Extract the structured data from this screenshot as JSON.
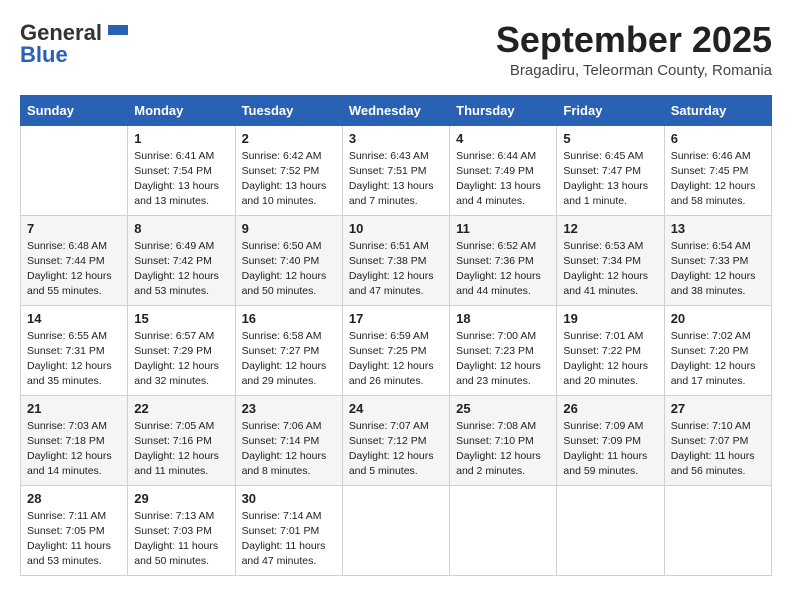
{
  "header": {
    "logo_general": "General",
    "logo_blue": "Blue",
    "month_title": "September 2025",
    "location": "Bragadiru, Teleorman County, Romania"
  },
  "weekdays": [
    "Sunday",
    "Monday",
    "Tuesday",
    "Wednesday",
    "Thursday",
    "Friday",
    "Saturday"
  ],
  "weeks": [
    [
      {
        "day": "",
        "info": ""
      },
      {
        "day": "1",
        "info": "Sunrise: 6:41 AM\nSunset: 7:54 PM\nDaylight: 13 hours\nand 13 minutes."
      },
      {
        "day": "2",
        "info": "Sunrise: 6:42 AM\nSunset: 7:52 PM\nDaylight: 13 hours\nand 10 minutes."
      },
      {
        "day": "3",
        "info": "Sunrise: 6:43 AM\nSunset: 7:51 PM\nDaylight: 13 hours\nand 7 minutes."
      },
      {
        "day": "4",
        "info": "Sunrise: 6:44 AM\nSunset: 7:49 PM\nDaylight: 13 hours\nand 4 minutes."
      },
      {
        "day": "5",
        "info": "Sunrise: 6:45 AM\nSunset: 7:47 PM\nDaylight: 13 hours\nand 1 minute."
      },
      {
        "day": "6",
        "info": "Sunrise: 6:46 AM\nSunset: 7:45 PM\nDaylight: 12 hours\nand 58 minutes."
      }
    ],
    [
      {
        "day": "7",
        "info": "Sunrise: 6:48 AM\nSunset: 7:44 PM\nDaylight: 12 hours\nand 55 minutes."
      },
      {
        "day": "8",
        "info": "Sunrise: 6:49 AM\nSunset: 7:42 PM\nDaylight: 12 hours\nand 53 minutes."
      },
      {
        "day": "9",
        "info": "Sunrise: 6:50 AM\nSunset: 7:40 PM\nDaylight: 12 hours\nand 50 minutes."
      },
      {
        "day": "10",
        "info": "Sunrise: 6:51 AM\nSunset: 7:38 PM\nDaylight: 12 hours\nand 47 minutes."
      },
      {
        "day": "11",
        "info": "Sunrise: 6:52 AM\nSunset: 7:36 PM\nDaylight: 12 hours\nand 44 minutes."
      },
      {
        "day": "12",
        "info": "Sunrise: 6:53 AM\nSunset: 7:34 PM\nDaylight: 12 hours\nand 41 minutes."
      },
      {
        "day": "13",
        "info": "Sunrise: 6:54 AM\nSunset: 7:33 PM\nDaylight: 12 hours\nand 38 minutes."
      }
    ],
    [
      {
        "day": "14",
        "info": "Sunrise: 6:55 AM\nSunset: 7:31 PM\nDaylight: 12 hours\nand 35 minutes."
      },
      {
        "day": "15",
        "info": "Sunrise: 6:57 AM\nSunset: 7:29 PM\nDaylight: 12 hours\nand 32 minutes."
      },
      {
        "day": "16",
        "info": "Sunrise: 6:58 AM\nSunset: 7:27 PM\nDaylight: 12 hours\nand 29 minutes."
      },
      {
        "day": "17",
        "info": "Sunrise: 6:59 AM\nSunset: 7:25 PM\nDaylight: 12 hours\nand 26 minutes."
      },
      {
        "day": "18",
        "info": "Sunrise: 7:00 AM\nSunset: 7:23 PM\nDaylight: 12 hours\nand 23 minutes."
      },
      {
        "day": "19",
        "info": "Sunrise: 7:01 AM\nSunset: 7:22 PM\nDaylight: 12 hours\nand 20 minutes."
      },
      {
        "day": "20",
        "info": "Sunrise: 7:02 AM\nSunset: 7:20 PM\nDaylight: 12 hours\nand 17 minutes."
      }
    ],
    [
      {
        "day": "21",
        "info": "Sunrise: 7:03 AM\nSunset: 7:18 PM\nDaylight: 12 hours\nand 14 minutes."
      },
      {
        "day": "22",
        "info": "Sunrise: 7:05 AM\nSunset: 7:16 PM\nDaylight: 12 hours\nand 11 minutes."
      },
      {
        "day": "23",
        "info": "Sunrise: 7:06 AM\nSunset: 7:14 PM\nDaylight: 12 hours\nand 8 minutes."
      },
      {
        "day": "24",
        "info": "Sunrise: 7:07 AM\nSunset: 7:12 PM\nDaylight: 12 hours\nand 5 minutes."
      },
      {
        "day": "25",
        "info": "Sunrise: 7:08 AM\nSunset: 7:10 PM\nDaylight: 12 hours\nand 2 minutes."
      },
      {
        "day": "26",
        "info": "Sunrise: 7:09 AM\nSunset: 7:09 PM\nDaylight: 11 hours\nand 59 minutes."
      },
      {
        "day": "27",
        "info": "Sunrise: 7:10 AM\nSunset: 7:07 PM\nDaylight: 11 hours\nand 56 minutes."
      }
    ],
    [
      {
        "day": "28",
        "info": "Sunrise: 7:11 AM\nSunset: 7:05 PM\nDaylight: 11 hours\nand 53 minutes."
      },
      {
        "day": "29",
        "info": "Sunrise: 7:13 AM\nSunset: 7:03 PM\nDaylight: 11 hours\nand 50 minutes."
      },
      {
        "day": "30",
        "info": "Sunrise: 7:14 AM\nSunset: 7:01 PM\nDaylight: 11 hours\nand 47 minutes."
      },
      {
        "day": "",
        "info": ""
      },
      {
        "day": "",
        "info": ""
      },
      {
        "day": "",
        "info": ""
      },
      {
        "day": "",
        "info": ""
      }
    ]
  ]
}
